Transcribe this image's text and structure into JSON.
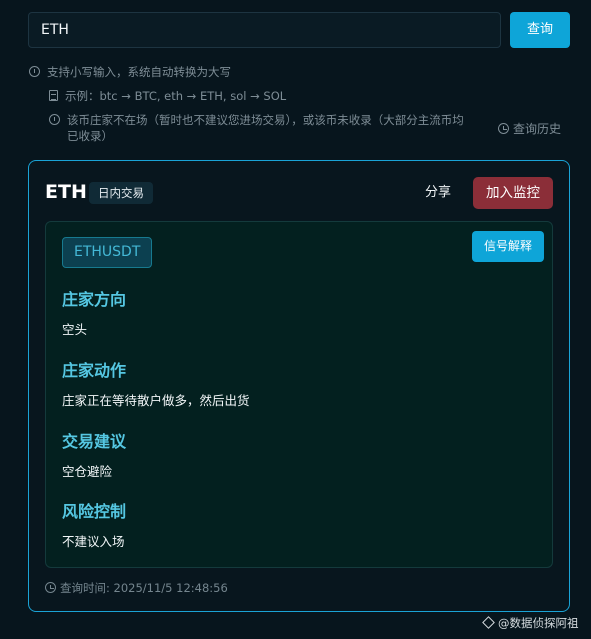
{
  "search": {
    "value": "ETH",
    "button_label": "查询"
  },
  "hints": {
    "line1": "支持小写输入，系统自动转换为大写",
    "line2": "示例：btc → BTC, eth → ETH, sol → SOL",
    "line3a": "该币庄家不在场（暂时也不建议您进场交易），或该币未收录（大部分主流币均",
    "line3b": "已收录）",
    "history_label": "查询历史"
  },
  "result": {
    "coin": "ETH",
    "tag": "日内交易",
    "share_label": "分享",
    "monitor_label": "加入监控",
    "pair": "ETHUSDT",
    "signal_label": "信号解释",
    "sections": [
      {
        "title": "庄家方向",
        "text": "空头"
      },
      {
        "title": "庄家动作",
        "text": "庄家正在等待散户做多，然后出货"
      },
      {
        "title": "交易建议",
        "text": "空仓避险"
      },
      {
        "title": "风险控制",
        "text": "不建议入场"
      }
    ],
    "query_time": "查询时间: 2025/11/5 12:48:56"
  },
  "watermark": "@数据侦探阿祖",
  "colors": {
    "accent": "#0ea5d8",
    "danger": "#8b2e38",
    "section_title": "#55c7e2"
  }
}
